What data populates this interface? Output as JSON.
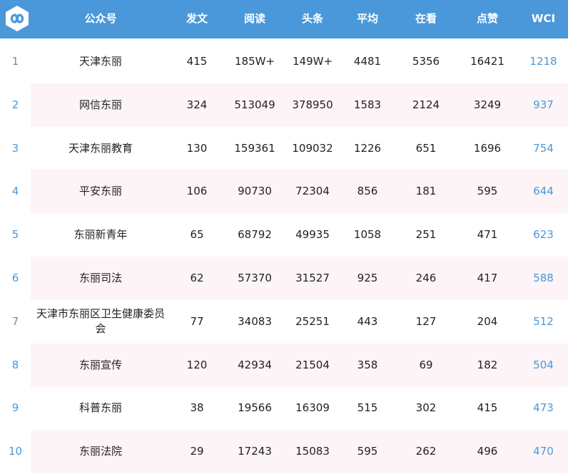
{
  "colors": {
    "header_bg": "#4a98da",
    "header_text": "#ffffff",
    "accent": "#4a98da",
    "stripe": "#fcf4f6"
  },
  "header": {
    "logo_icon": "infinity-logo-icon",
    "columns": [
      "公众号",
      "发文",
      "阅读",
      "头条",
      "平均",
      "在看",
      "点赞",
      "WCI"
    ]
  },
  "rows": [
    {
      "rank": "1",
      "name": "天津东丽",
      "posts": "415",
      "reads": "185W+",
      "headline": "149W+",
      "avg": "4481",
      "watching": "5356",
      "likes": "16421",
      "wci": "1218"
    },
    {
      "rank": "2",
      "name": "网信东丽",
      "posts": "324",
      "reads": "513049",
      "headline": "378950",
      "avg": "1583",
      "watching": "2124",
      "likes": "3249",
      "wci": "937"
    },
    {
      "rank": "3",
      "name": "天津东丽教育",
      "posts": "130",
      "reads": "159361",
      "headline": "109032",
      "avg": "1226",
      "watching": "651",
      "likes": "1696",
      "wci": "754"
    },
    {
      "rank": "4",
      "name": "平安东丽",
      "posts": "106",
      "reads": "90730",
      "headline": "72304",
      "avg": "856",
      "watching": "181",
      "likes": "595",
      "wci": "644"
    },
    {
      "rank": "5",
      "name": "东丽新青年",
      "posts": "65",
      "reads": "68792",
      "headline": "49935",
      "avg": "1058",
      "watching": "251",
      "likes": "471",
      "wci": "623"
    },
    {
      "rank": "6",
      "name": "东丽司法",
      "posts": "62",
      "reads": "57370",
      "headline": "31527",
      "avg": "925",
      "watching": "246",
      "likes": "417",
      "wci": "588"
    },
    {
      "rank": "7",
      "name": "天津市东丽区卫生健康委员会",
      "posts": "77",
      "reads": "34083",
      "headline": "25251",
      "avg": "443",
      "watching": "127",
      "likes": "204",
      "wci": "512"
    },
    {
      "rank": "8",
      "name": "东丽宣传",
      "posts": "120",
      "reads": "42934",
      "headline": "21504",
      "avg": "358",
      "watching": "69",
      "likes": "182",
      "wci": "504"
    },
    {
      "rank": "9",
      "name": "科普东丽",
      "posts": "38",
      "reads": "19566",
      "headline": "16309",
      "avg": "515",
      "watching": "302",
      "likes": "415",
      "wci": "473"
    },
    {
      "rank": "10",
      "name": "东丽法院",
      "posts": "29",
      "reads": "17243",
      "headline": "15083",
      "avg": "595",
      "watching": "262",
      "likes": "496",
      "wci": "470"
    }
  ]
}
